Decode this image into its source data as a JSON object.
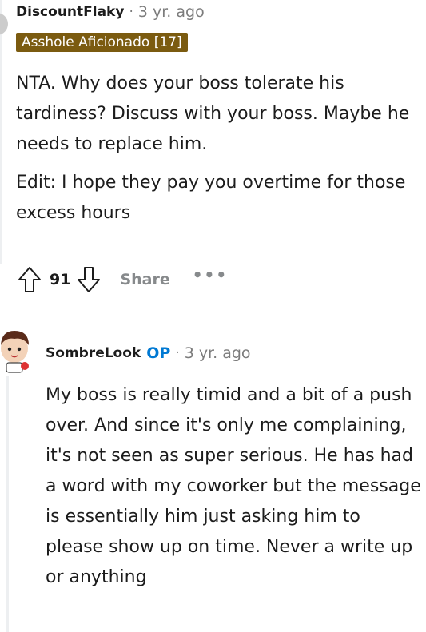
{
  "comment1": {
    "username": "DiscountFlaky",
    "separator": "·",
    "timestamp": "3 yr. ago",
    "flair": "Asshole Aficionado [17]",
    "paragraphs": [
      "NTA. Why does your boss tolerate his tardiness? Discuss with your boss. Maybe he needs to replace him.",
      "Edit: I hope they pay you overtime for those excess hours"
    ],
    "score": "91",
    "share_label": "Share",
    "more_label": "•••"
  },
  "comment2": {
    "username": "SombreLook",
    "op_badge": "OP",
    "separator": "·",
    "timestamp": "3 yr. ago",
    "body": "My boss is really timid and a bit of a push over. And since it's only me complaining, it's not seen as super serious. He has had a word with my coworker but the message is essentially him just asking him to please show up on time. Never a write up or anything"
  },
  "colors": {
    "flair_bg": "#7b5b10",
    "op_blue": "#0079d3",
    "muted": "#7c7c7c"
  }
}
